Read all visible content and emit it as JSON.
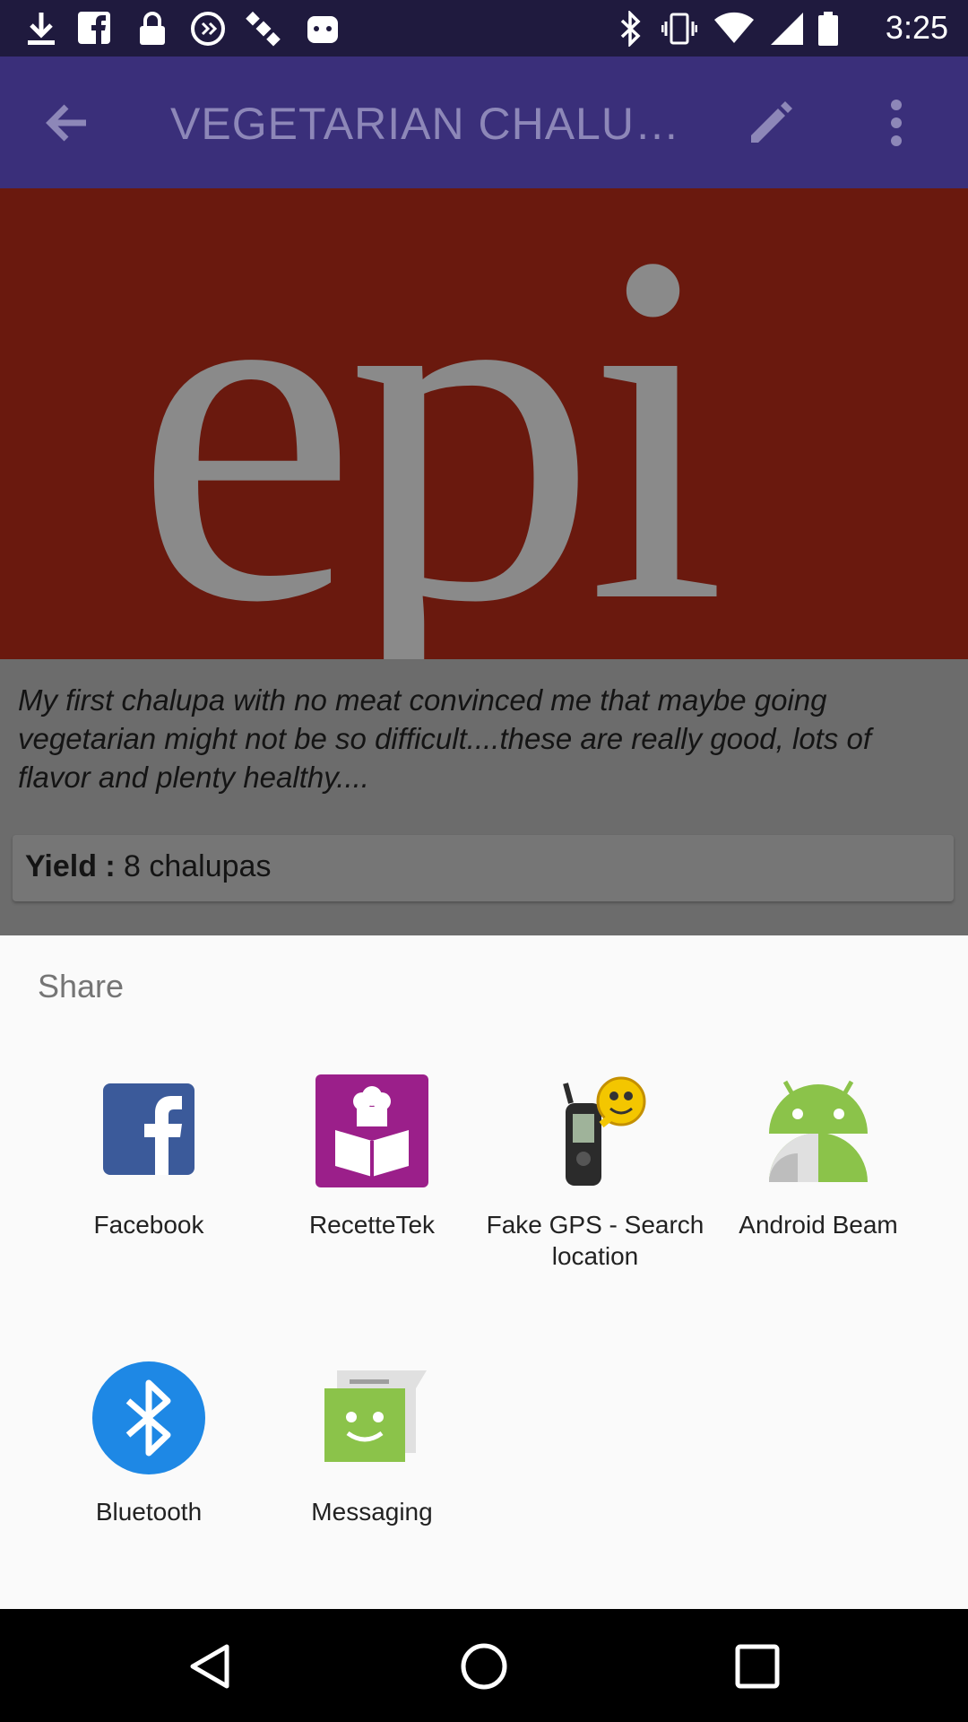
{
  "status_bar": {
    "time": "3:25",
    "icons": [
      "download-icon",
      "facebook-icon",
      "lock-icon",
      "sync-icon",
      "satellite-icon",
      "game-icon",
      "bluetooth-icon",
      "vibrate-icon",
      "wifi-icon",
      "signal-icon",
      "battery-icon"
    ]
  },
  "app_bar": {
    "title": "VEGETARIAN CHALUP…",
    "back_icon": "arrow-back-icon",
    "edit_icon": "pencil-icon",
    "more_icon": "more-vert-icon"
  },
  "hero": {
    "logo_text": "epi",
    "background_color": "#6a190e",
    "logo_color": "#8a8a8a"
  },
  "description": {
    "text": "My first chalupa with no meat convinced me that maybe going vegetarian might not be so difficult....these are really good, lots of flavor and plenty healthy....",
    "yield_label": "Yield :",
    "yield_value": "8 chalupas"
  },
  "share_sheet": {
    "title": "Share",
    "apps": [
      {
        "label": "Facebook",
        "icon": "facebook-icon",
        "color": "#3b5a9a"
      },
      {
        "label": "RecetteTek",
        "icon": "recipe-book-icon",
        "color": "#9b1f8a"
      },
      {
        "label": "Fake GPS - Search location",
        "icon": "gps-device-icon",
        "color": "#f3c600"
      },
      {
        "label": "Android Beam",
        "icon": "android-icon",
        "color": "#8bc34a"
      },
      {
        "label": "Bluetooth",
        "icon": "bluetooth-icon",
        "color": "#1e88e5"
      },
      {
        "label": "Messaging",
        "icon": "message-icon",
        "color": "#8bc34a"
      }
    ]
  },
  "nav_bar": {
    "buttons": [
      "back-triangle-icon",
      "home-circle-icon",
      "recents-square-icon"
    ]
  }
}
